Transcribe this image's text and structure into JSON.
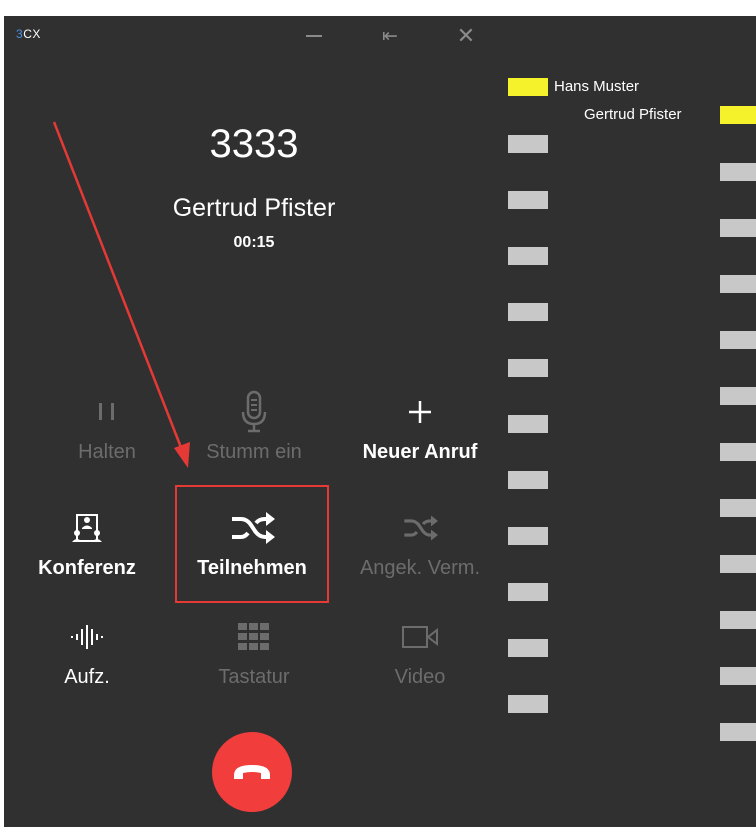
{
  "app": {
    "logo_prefix": "3",
    "logo_rest": "CX"
  },
  "call": {
    "number": "3333",
    "name": "Gertrud Pfister",
    "duration": "00:15"
  },
  "actions": [
    {
      "key": "hold",
      "label": "Halten",
      "icon": "pause-icon",
      "enabled": false
    },
    {
      "key": "mute",
      "label": "Stumm ein",
      "icon": "microphone-icon",
      "enabled": false
    },
    {
      "key": "new_call",
      "label": "Neuer Anruf",
      "icon": "plus-icon",
      "enabled": true
    },
    {
      "key": "conference",
      "label": "Konferenz",
      "icon": "conference-icon",
      "enabled": true
    },
    {
      "key": "join",
      "label": "Teilnehmen",
      "icon": "shuffle-icon",
      "enabled": true,
      "highlighted": true
    },
    {
      "key": "attended_transfer",
      "label": "Angek. Verm.",
      "icon": "shuffle-icon",
      "enabled": false
    },
    {
      "key": "record",
      "label": "Aufz.",
      "icon": "soundwave-icon",
      "enabled": true
    },
    {
      "key": "keypad",
      "label": "Tastatur",
      "icon": "keypad-icon",
      "enabled": false
    },
    {
      "key": "video",
      "label": "Video",
      "icon": "video-camera-icon",
      "enabled": false
    }
  ],
  "hangup": {
    "icon": "hangup-phone-icon"
  },
  "side_panel": {
    "participants": [
      "Hans Muster",
      "Gertrud Pfister"
    ]
  },
  "colors": {
    "background": "#303030",
    "text": "#ffffff",
    "disabled": "#6c6c6c",
    "hangup": "#f23d3d",
    "highlight_box": "#e53935",
    "participant_tag": "#f5f22b",
    "placeholder": "#c8c8c8",
    "logo_accent": "#4a90e2"
  }
}
